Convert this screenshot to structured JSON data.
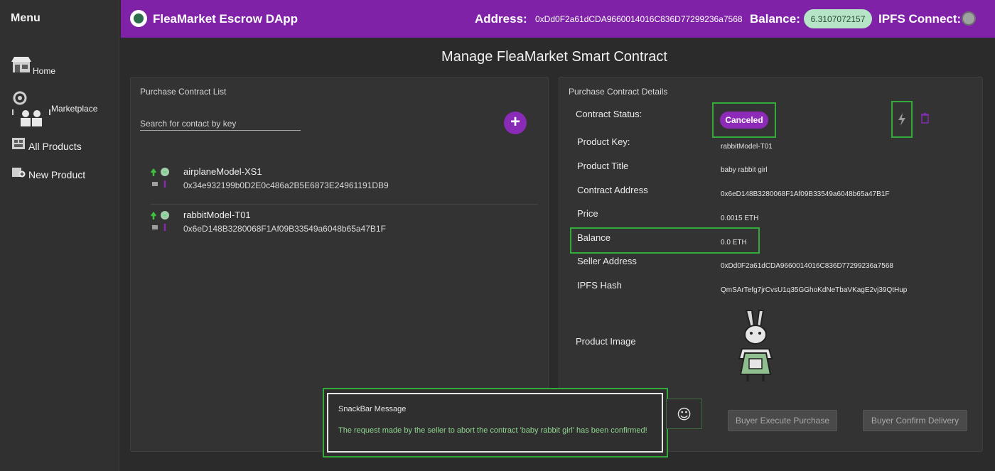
{
  "sidebar": {
    "title": "Menu",
    "items": [
      {
        "label": "Home",
        "icon": "store-icon"
      },
      {
        "label": "Marketplace",
        "icon": "gear-people-icon"
      },
      {
        "label": "All Products",
        "icon": "product-list-icon"
      },
      {
        "label": "New Product",
        "icon": "new-product-icon"
      }
    ]
  },
  "header": {
    "app_title": "FleaMarket Escrow DApp",
    "address_label": "Address:",
    "address_value": "0xDd0F2a61dCDA9660014016C836D77299236a7568",
    "balance_label": "Balance:",
    "balance_value": "6.3107072157",
    "ipfs_label": "IPFS Connect:",
    "colors": {
      "header_bg": "#7f22a8",
      "balance_chip": "#b5e4c6",
      "ipfs_status": "#9ea3a0"
    }
  },
  "page_title": "Manage FleaMarket Smart Contract",
  "contract_list": {
    "title": "Purchase Contract List",
    "search_placeholder": "Search for contact by key",
    "add_label": "+",
    "items": [
      {
        "name": "airplaneModel-XS1",
        "address": "0x34e932199b0D2E0c486a2B5E6873E24961191DB9"
      },
      {
        "name": "rabbitModel-T01",
        "address": "0x6eD148B3280068F1Af09B33549a6048b65a47B1F"
      }
    ]
  },
  "details": {
    "title": "Purchase Contract Details",
    "status_label": "Contract Status:",
    "status_value": "Canceled",
    "fields": {
      "product_key": {
        "label": "Product Key:",
        "value": "rabbitModel-T01"
      },
      "product_title": {
        "label": "Product Title",
        "value": "baby rabbit girl"
      },
      "contract_address": {
        "label": "Contract Address",
        "value": "0x6eD148B3280068F1Af09B33549a6048b65a47B1F"
      },
      "price": {
        "label": "Price",
        "value": "0.0015 ETH"
      },
      "balance": {
        "label": "Balance",
        "value": "0.0 ETH"
      },
      "seller_address": {
        "label": "Seller Address",
        "value": "0xDd0F2a61dCDA9660014016C836D77299236a7568"
      },
      "ipfs_hash": {
        "label": "IPFS Hash",
        "value": "QmSArTefg7jrCvsU1q35GGhoKdNeTbaVKagE2vj39QtHup"
      }
    },
    "image_label": "Product Image",
    "buttons": {
      "execute_purchase": "Buyer Execute Purchase",
      "confirm_delivery": "Buyer Confirm Delivery"
    }
  },
  "snackbar": {
    "title": "SnackBar Message",
    "message": "The request made by the seller to abort the contract 'baby rabbit girl' has been confirmed!",
    "emoji": "☺"
  }
}
